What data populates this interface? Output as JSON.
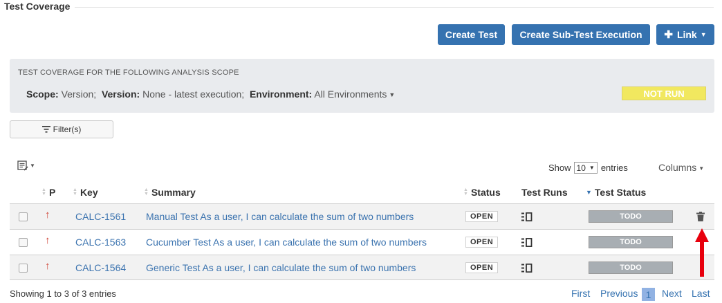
{
  "section": {
    "title": "Test Coverage"
  },
  "actions": {
    "create_test": "Create Test",
    "create_sub_test": "Create Sub-Test Execution",
    "link": "Link"
  },
  "scope": {
    "heading": "TEST COVERAGE FOR THE FOLLOWING ANALYSIS SCOPE",
    "scope_label": "Scope:",
    "scope_value": "Version;",
    "version_label": "Version:",
    "version_value": "None - latest execution;",
    "environment_label": "Environment:",
    "environment_value": "All Environments",
    "overall_status": "NOT RUN"
  },
  "filter": {
    "label": "Filter(s)"
  },
  "table_controls": {
    "show_label": "Show",
    "entries_value": "10",
    "entries_label": "entries",
    "columns_label": "Columns"
  },
  "columns": {
    "priority": "P",
    "key": "Key",
    "summary": "Summary",
    "status": "Status",
    "test_runs": "Test Runs",
    "test_status": "Test Status"
  },
  "rows": [
    {
      "key": "CALC-1561",
      "summary": "Manual Test As a user, I can calculate the sum of two numbers",
      "status": "OPEN",
      "test_status": "TODO"
    },
    {
      "key": "CALC-1563",
      "summary": "Cucumber Test As a user, I can calculate the sum of two numbers",
      "status": "OPEN",
      "test_status": "TODO"
    },
    {
      "key": "CALC-1564",
      "summary": "Generic Test As a user, I can calculate the sum of two numbers",
      "status": "OPEN",
      "test_status": "TODO"
    }
  ],
  "footer": {
    "showing": "Showing 1 to 3 of 3 entries",
    "first": "First",
    "previous": "Previous",
    "current_page": "1",
    "next": "Next",
    "last": "Last"
  },
  "colors": {
    "primary_button": "#3572b0",
    "not_run_badge": "#f1e85f",
    "todo_badge": "#a8aeb3",
    "priority_arrow": "#d04437",
    "annotation_arrow": "#e8000d",
    "link": "#3b73af"
  },
  "icons": {
    "priority": "arrow-up-icon",
    "test_runs": "test-runs-icon",
    "delete": "trash-icon",
    "export": "export-icon",
    "filter": "filter-icon",
    "annotation": "red-arrow-pointing-to-trash"
  }
}
